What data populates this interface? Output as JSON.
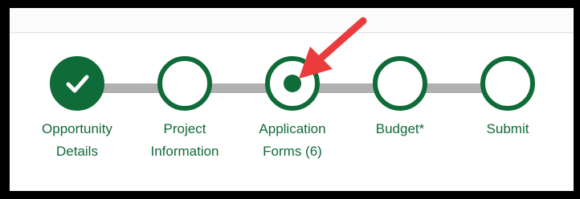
{
  "stepper": {
    "steps": [
      {
        "label": "Opportunity\nDetails",
        "state": "complete",
        "icon": "checkmark-icon"
      },
      {
        "label": "Project\nInformation",
        "state": "incomplete"
      },
      {
        "label": "Application\nForms (6)",
        "state": "current",
        "icon": "current-dot-icon"
      },
      {
        "label": "Budget*",
        "state": "incomplete"
      },
      {
        "label": "Submit",
        "state": "incomplete"
      }
    ]
  },
  "colors": {
    "brand_green": "#0f6b38",
    "connector_gray": "#b0b0b0",
    "annotation_red": "#ea3c3c"
  },
  "annotation": {
    "icon": "red-arrow-icon"
  }
}
